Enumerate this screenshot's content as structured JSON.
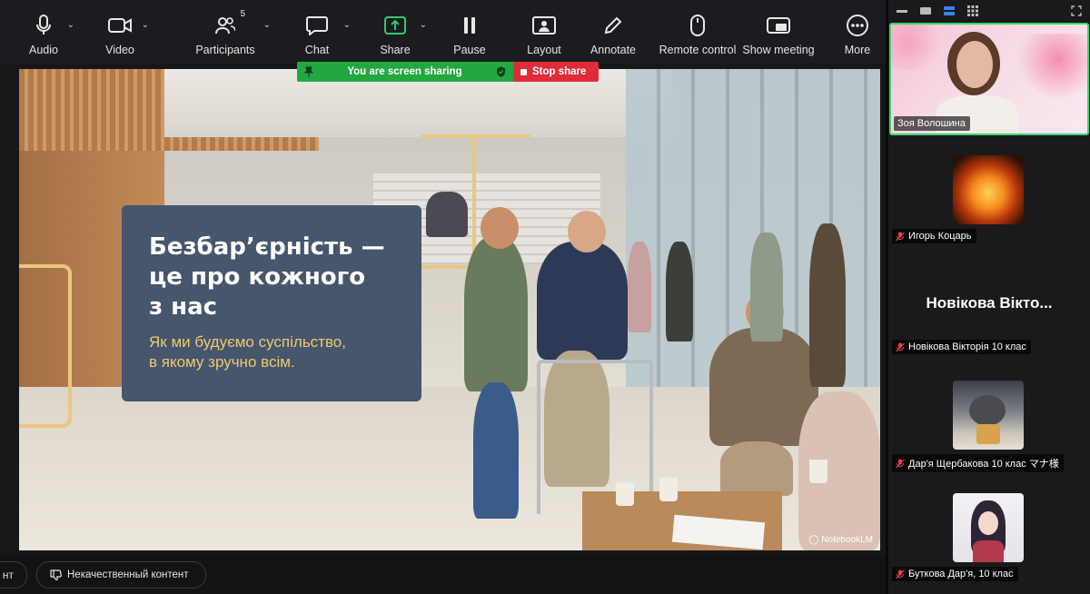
{
  "toolbar": {
    "items": [
      {
        "id": "audio",
        "label": "Audio",
        "icon": "microphone-icon",
        "caret": true
      },
      {
        "id": "video",
        "label": "Video",
        "icon": "video-camera-icon",
        "caret": true
      },
      {
        "id": "participants",
        "label": "Participants",
        "icon": "participants-icon",
        "caret": true,
        "count": "5"
      },
      {
        "id": "chat",
        "label": "Chat",
        "icon": "chat-bubble-icon",
        "caret": true
      },
      {
        "id": "share",
        "label": "Share",
        "icon": "share-screen-icon",
        "caret": true
      },
      {
        "id": "pause",
        "label": "Pause",
        "icon": "pause-icon"
      },
      {
        "id": "layout",
        "label": "Layout",
        "icon": "layout-icon"
      },
      {
        "id": "annotate",
        "label": "Annotate",
        "icon": "pencil-icon"
      },
      {
        "id": "remote",
        "label": "Remote control",
        "icon": "mouse-icon"
      },
      {
        "id": "show_meeting",
        "label": "Show meeting",
        "icon": "show-meeting-icon"
      },
      {
        "id": "more",
        "label": "More",
        "icon": "more-dots-icon"
      }
    ]
  },
  "share_banner": {
    "status": "You are screen sharing",
    "stop": "Stop share",
    "status_color": "#23a840",
    "stop_color": "#e02c3a"
  },
  "slide": {
    "title_lines": [
      "Безбар’єрність —",
      "це про кожного",
      "з нас"
    ],
    "subtitle_lines": [
      "Як ми будуємо суспільство,",
      "в якому зручно всім."
    ],
    "watermark": "NotebookLM",
    "card_color": "#45566d",
    "accent_color": "#f0c96f"
  },
  "bottom_bar": {
    "left_partial": "нт",
    "report_label": "Некачественный контент"
  },
  "participants": [
    {
      "name": "Зоя Волошина",
      "active": true,
      "muted": false
    },
    {
      "name": "Игорь Коцарь",
      "muted": true,
      "avatar": "fire"
    },
    {
      "name": "Новікова Вікторія 10 клас",
      "muted": true,
      "display": "Новікова Вікто..."
    },
    {
      "name": "Дар'я Щербакова 10 клас マナ様",
      "muted": true,
      "avatar": "cat"
    },
    {
      "name": "Буткова Дар'я, 10 клас",
      "muted": true,
      "avatar": "anime"
    }
  ],
  "colors": {
    "active_speaker_border": "#3bd36a",
    "muted_icon": "#e8414b"
  }
}
